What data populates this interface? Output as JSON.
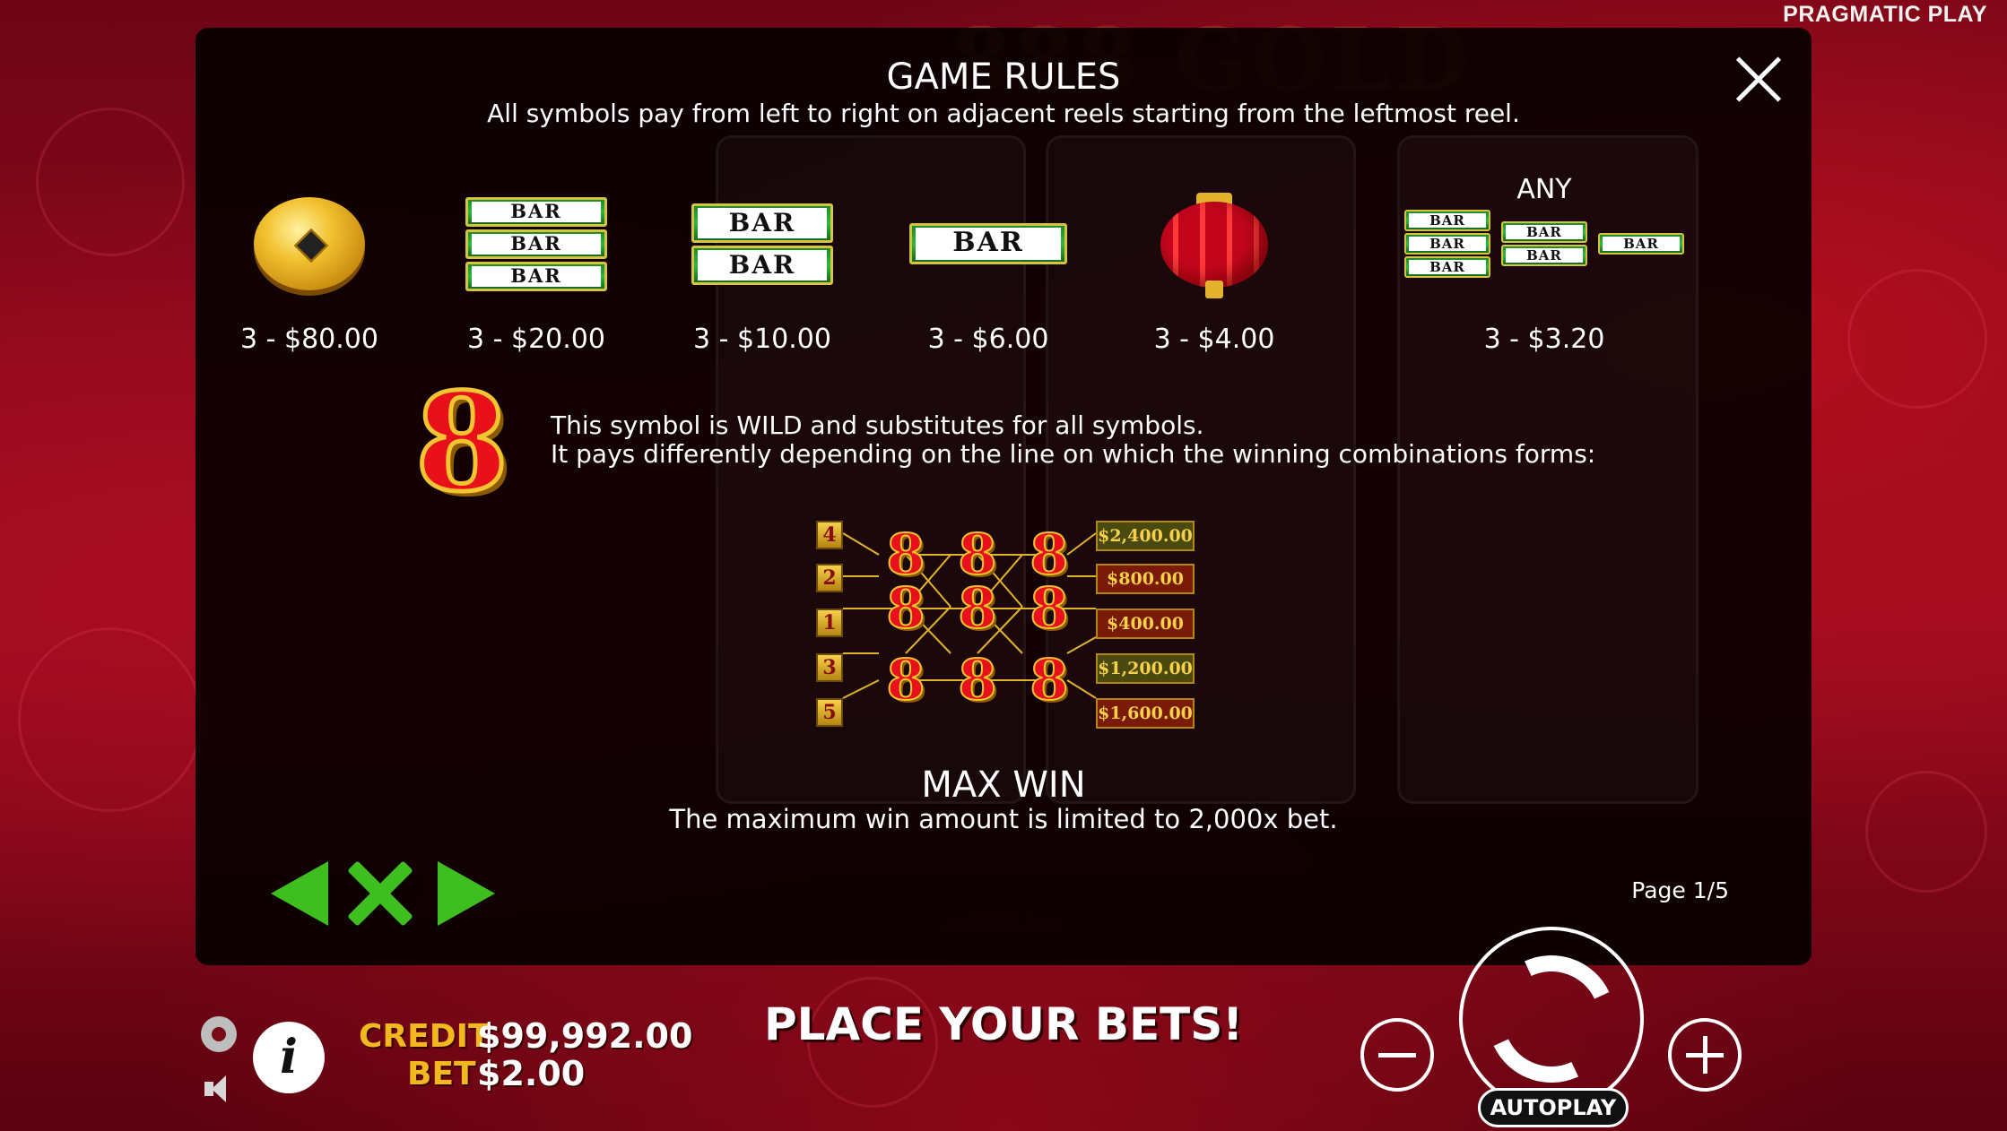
{
  "brand": "PRAGMATIC PLAY",
  "modal": {
    "title": "GAME RULES",
    "subtitle": "All symbols pay from left to right on adjacent reels starting from the leftmost reel.",
    "page": "Page 1/5"
  },
  "paytable": [
    {
      "icon": "gold-coin-icon",
      "pay": "3 - $80.00"
    },
    {
      "icon": "triple-bar-icon",
      "pay": "3 - $20.00"
    },
    {
      "icon": "double-bar-icon",
      "pay": "3 - $10.00"
    },
    {
      "icon": "single-bar-icon",
      "pay": "3 - $6.00"
    },
    {
      "icon": "red-lantern-icon",
      "pay": "3 - $4.00"
    },
    {
      "icon": "any-bar-icon",
      "pay": "3 - $3.20",
      "header": "ANY"
    }
  ],
  "bar_text": "BAR",
  "wild": {
    "symbol": "8",
    "line1": "This symbol is WILD and substitutes for all symbols.",
    "line2": "It pays differently depending on the line on which the winning combinations forms:"
  },
  "lines": [
    {
      "number": "4",
      "pay": "$2,400.00"
    },
    {
      "number": "2",
      "pay": "$800.00"
    },
    {
      "number": "1",
      "pay": "$400.00"
    },
    {
      "number": "3",
      "pay": "$1,200.00"
    },
    {
      "number": "5",
      "pay": "$1,600.00"
    }
  ],
  "max_win": {
    "title": "MAX WIN",
    "text": "The maximum win amount is limited to 2,000x bet."
  },
  "footer": {
    "credit_label": "CREDIT",
    "credit_value": "$99,992.00",
    "bet_label": "BET",
    "bet_value": "$2.00",
    "status": "PLACE YOUR BETS!",
    "autoplay": "AUTOPLAY",
    "info": "i"
  },
  "colors": {
    "accent_green": "#3fbf1f",
    "gold": "#f2b81f",
    "background_red": "#9c0b1f"
  }
}
